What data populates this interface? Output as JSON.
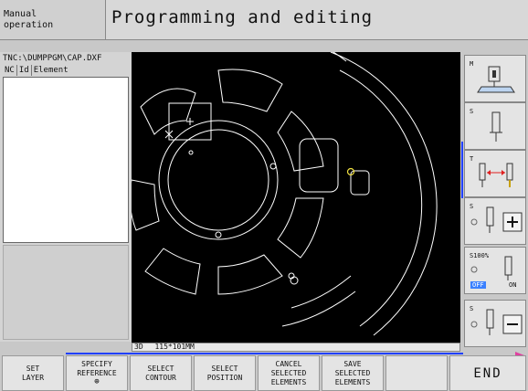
{
  "header": {
    "mode_line1": "Manual",
    "mode_line2": "operation",
    "title": "Programming and editing"
  },
  "file_panel": {
    "path": "TNC:\\DUMPPGM\\CAP.DXF",
    "columns": [
      "NC",
      "Id",
      "Element"
    ]
  },
  "status_bar": {
    "mode": "3D",
    "dimensions": "115*101MM"
  },
  "side_softkeys": [
    {
      "label": "M",
      "icon": "machine-table-icon"
    },
    {
      "label": "S",
      "icon": "spindle-icon"
    },
    {
      "label": "T",
      "icon": "tool-change-icon"
    },
    {
      "label": "S",
      "icon": "spindle-plus-icon"
    },
    {
      "label": "S100%",
      "off": "OFF",
      "on": "ON"
    },
    {
      "label": "S",
      "icon": "spindle-minus-icon"
    }
  ],
  "bottom_softkeys": [
    {
      "line1": "SET",
      "line2": "LAYER",
      "line3": ""
    },
    {
      "line1": "SPECIFY",
      "line2": "REFERENCE",
      "line3": ""
    },
    {
      "line1": "SELECT",
      "line2": "CONTOUR",
      "line3": ""
    },
    {
      "line1": "SELECT",
      "line2": "POSITION",
      "line3": ""
    },
    {
      "line1": "CANCEL",
      "line2": "SELECTED",
      "line3": "ELEMENTS"
    },
    {
      "line1": "SAVE",
      "line2": "SELECTED",
      "line3": "ELEMENTS"
    },
    {
      "line1": "",
      "line2": "",
      "line3": ""
    },
    {
      "line1": "END",
      "line2": "",
      "line3": ""
    }
  ],
  "colors": {
    "canvas": "#000000",
    "contour": "#ffffff",
    "highlight_point": "#f0e040",
    "active_indicator": "#2040ff",
    "off_badge": "#3a80ff"
  }
}
